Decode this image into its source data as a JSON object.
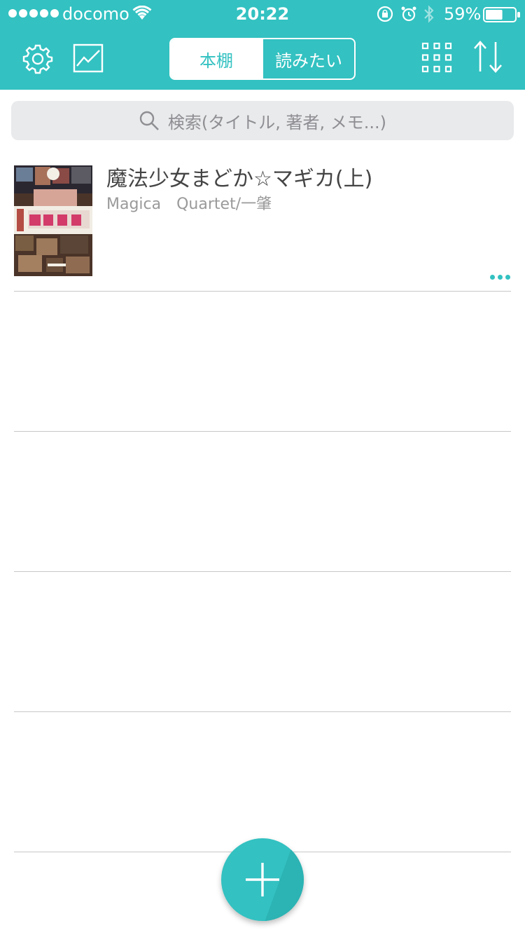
{
  "status_bar": {
    "carrier": "docomo",
    "time": "20:22",
    "battery_percent": "59%",
    "battery_level": 0.59
  },
  "header": {
    "segments": [
      {
        "label": "本棚",
        "active": true
      },
      {
        "label": "読みたい",
        "active": false
      }
    ],
    "icons": [
      "gear-icon",
      "stats-chart-icon",
      "grid-view-icon",
      "sort-icon"
    ]
  },
  "search": {
    "placeholder": "検索(タイトル, 著者, メモ...)"
  },
  "books": [
    {
      "title": "魔法少女まどか☆マギカ(上)",
      "author": "Magica　Quartet/一肇"
    }
  ],
  "colors": {
    "accent": "#33c1c1",
    "search_bg": "#e9eaeb",
    "divider": "#c8c8c8"
  }
}
